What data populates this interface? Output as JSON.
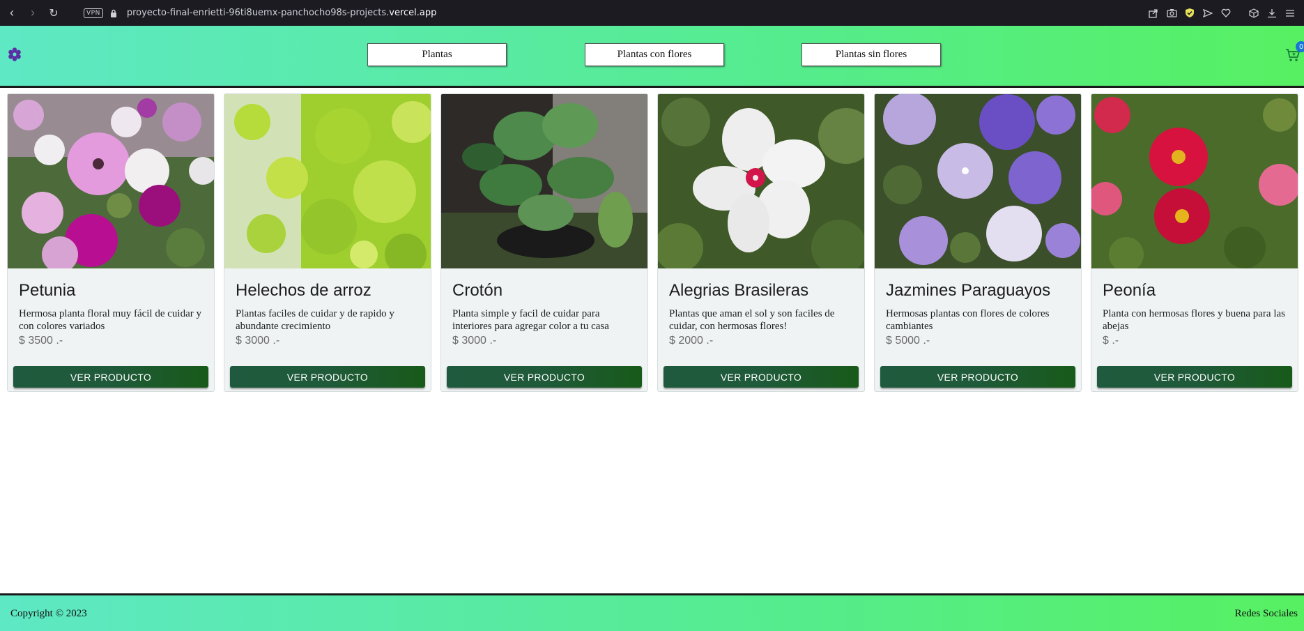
{
  "browser": {
    "url_prefix": "proyecto-final-enrietti-96ti8uemx-panchocho98s-projects.",
    "url_domain": "vercel.app",
    "vpn_label": "VPN",
    "back_icon": "‹",
    "forward_icon": "›",
    "reload_icon": "↻"
  },
  "header": {
    "nav": [
      {
        "label": "Plantas"
      },
      {
        "label": "Plantas con flores"
      },
      {
        "label": "Plantas sin flores"
      }
    ],
    "cart_count": "0",
    "accent": "#5b2ea6"
  },
  "products": [
    {
      "name": "Petunia",
      "description": "Hermosa planta floral muy fácil de cuidar y con colores variados",
      "price": "$ 3500 .-",
      "button": "VER PRODUCTO"
    },
    {
      "name": "Helechos de arroz",
      "description": "Plantas faciles de cuidar y de rapido y abundante crecimiento",
      "price": "$ 3000 .-",
      "button": "VER PRODUCTO"
    },
    {
      "name": "Crotón",
      "description": "Planta simple y facil de cuidar para interiores para agregar color a tu casa",
      "price": "$ 3000 .-",
      "button": "VER PRODUCTO"
    },
    {
      "name": "Alegrias Brasileras",
      "description": "Plantas que aman el sol y son faciles de cuidar, con hermosas flores!",
      "price": "$ 2000 .-",
      "button": "VER PRODUCTO"
    },
    {
      "name": "Jazmines Paraguayos",
      "description": "Hermosas plantas con flores de colores cambiantes",
      "price": "$ 5000 .-",
      "button": "VER PRODUCTO"
    },
    {
      "name": "Peonía",
      "description": "Planta con hermosas flores y buena para las abejas",
      "price": "$ .-",
      "button": "VER PRODUCTO"
    }
  ],
  "footer": {
    "copyright": "Copyright © 2023",
    "social": "Redes Sociales"
  }
}
